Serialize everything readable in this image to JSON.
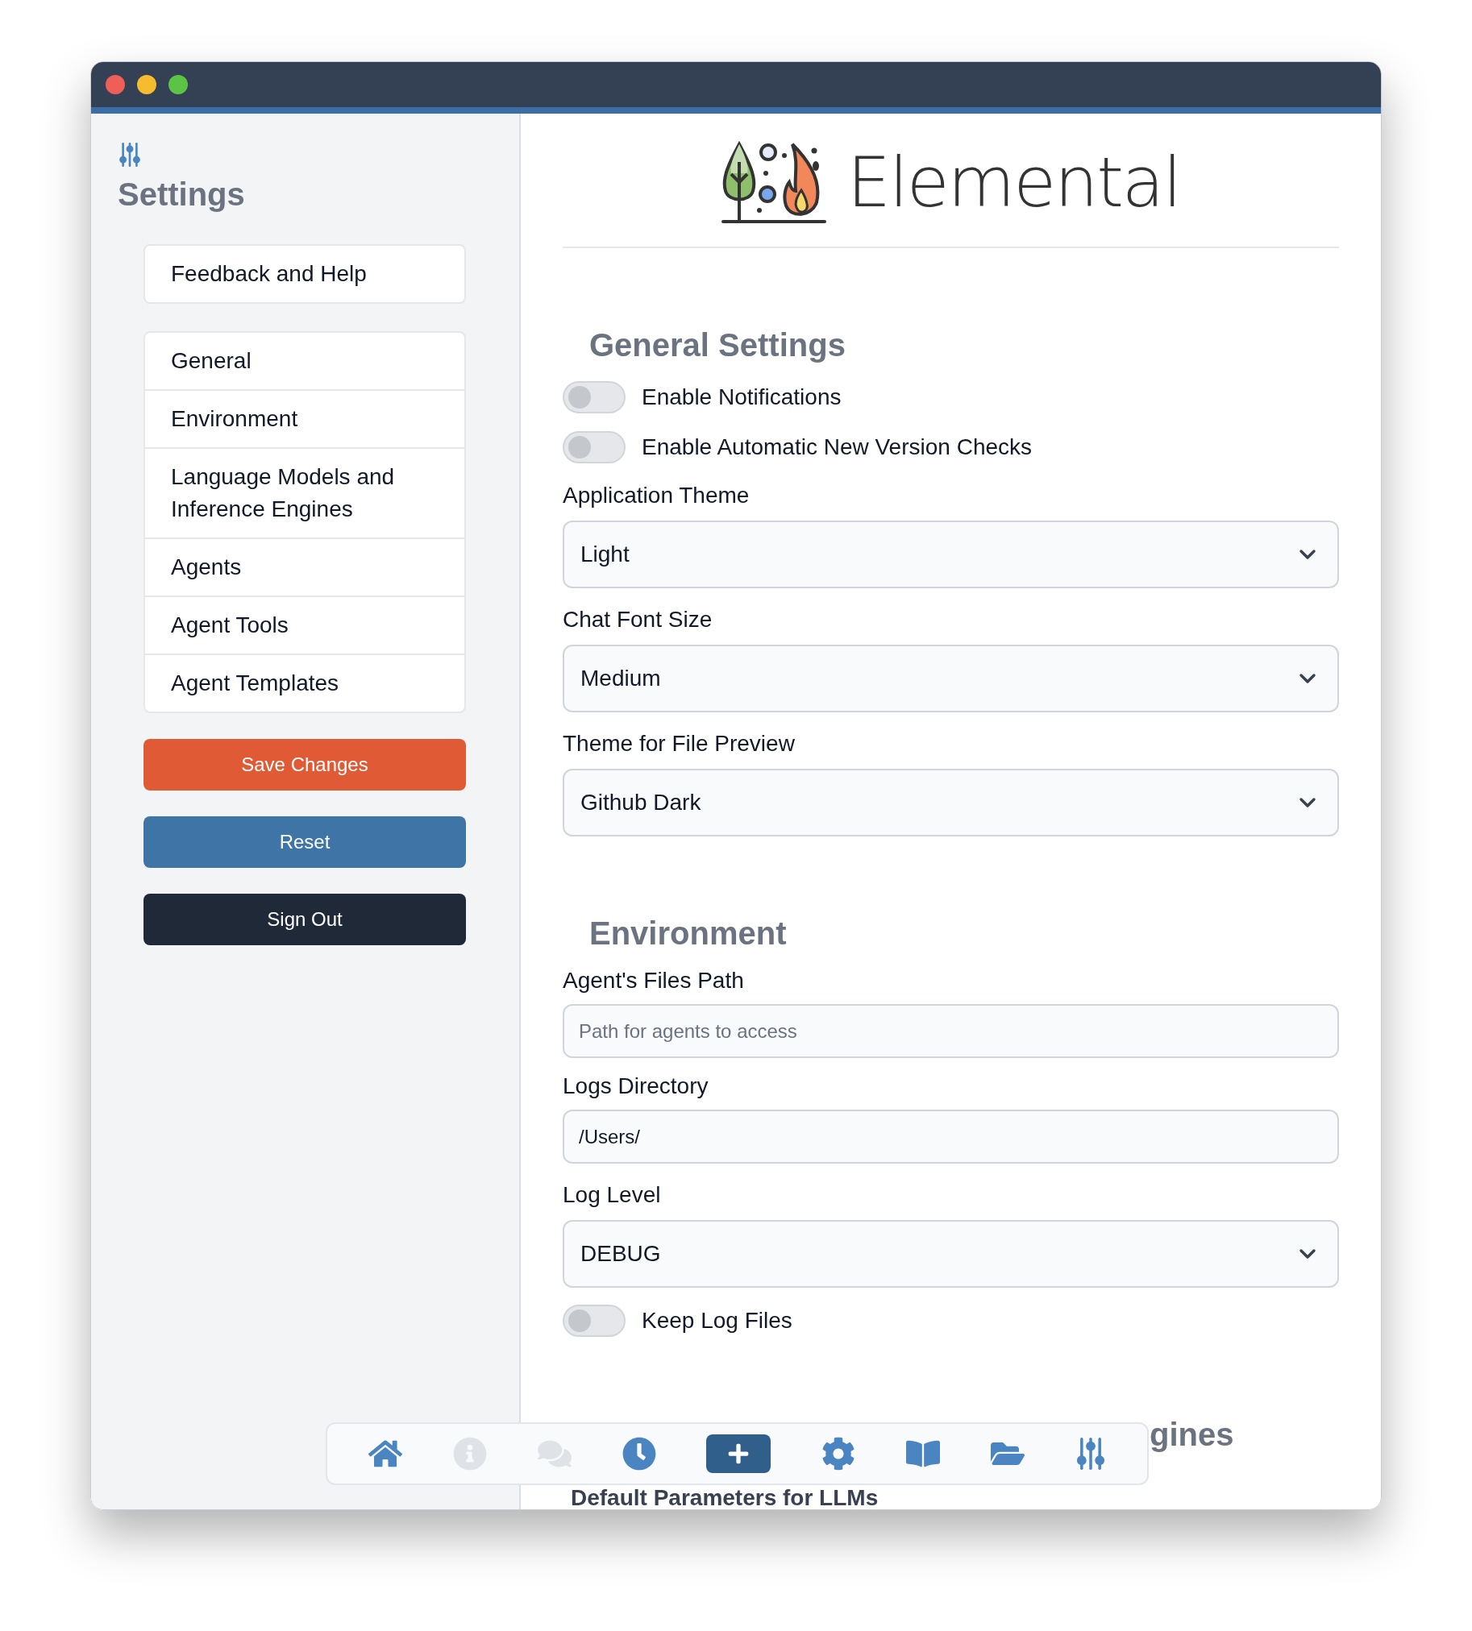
{
  "sidebar": {
    "title": "Settings",
    "help": "Feedback and Help",
    "items": [
      {
        "label": "General"
      },
      {
        "label": "Environment"
      },
      {
        "label": "Language Models and Inference Engines"
      },
      {
        "label": "Agents"
      },
      {
        "label": "Agent Tools"
      },
      {
        "label": "Agent Templates"
      }
    ],
    "buttons": [
      {
        "label": "Save Changes",
        "kind": "save"
      },
      {
        "label": "Reset",
        "kind": "reset"
      },
      {
        "label": "Sign Out",
        "kind": "signout"
      }
    ]
  },
  "header": {
    "app_name": "Elemental"
  },
  "sections": [
    {
      "title": "General Settings",
      "kind": "full",
      "fields": [
        {
          "kind": "toggle",
          "label": "Enable Notifications",
          "on": false
        },
        {
          "kind": "toggle",
          "label": "Enable Automatic New Version Checks",
          "on": false
        },
        {
          "kind": "select",
          "label": "Application Theme",
          "value": "Light"
        },
        {
          "kind": "select",
          "label": "Chat Font Size",
          "value": "Medium"
        },
        {
          "kind": "select",
          "label": "Theme for File Preview",
          "value": "Github Dark"
        }
      ]
    },
    {
      "title": "Environment",
      "kind": "full",
      "fields": [
        {
          "kind": "input",
          "label": "Agent's Files Path",
          "placeholder": "Path for agents to access"
        },
        {
          "kind": "input",
          "label": "Logs Directory",
          "value": "/Users/"
        },
        {
          "kind": "select",
          "label": "Log Level",
          "value": "DEBUG"
        },
        {
          "kind": "toggle",
          "label": "Keep Log Files",
          "on": false
        }
      ]
    },
    {
      "title": "gines",
      "kind": "covered",
      "fields": [
        {
          "kind": "subheading",
          "label": "Default Parameters for LLMs"
        }
      ]
    }
  ],
  "toolbar": [
    {
      "kind": "home",
      "disabled": false
    },
    {
      "kind": "info",
      "disabled": true
    },
    {
      "kind": "chat",
      "disabled": true
    },
    {
      "kind": "history",
      "disabled": false
    },
    {
      "kind": "add",
      "disabled": false
    },
    {
      "kind": "settings",
      "disabled": false
    },
    {
      "kind": "book",
      "disabled": false
    },
    {
      "kind": "folder",
      "disabled": false
    },
    {
      "kind": "sliders",
      "disabled": false
    }
  ]
}
